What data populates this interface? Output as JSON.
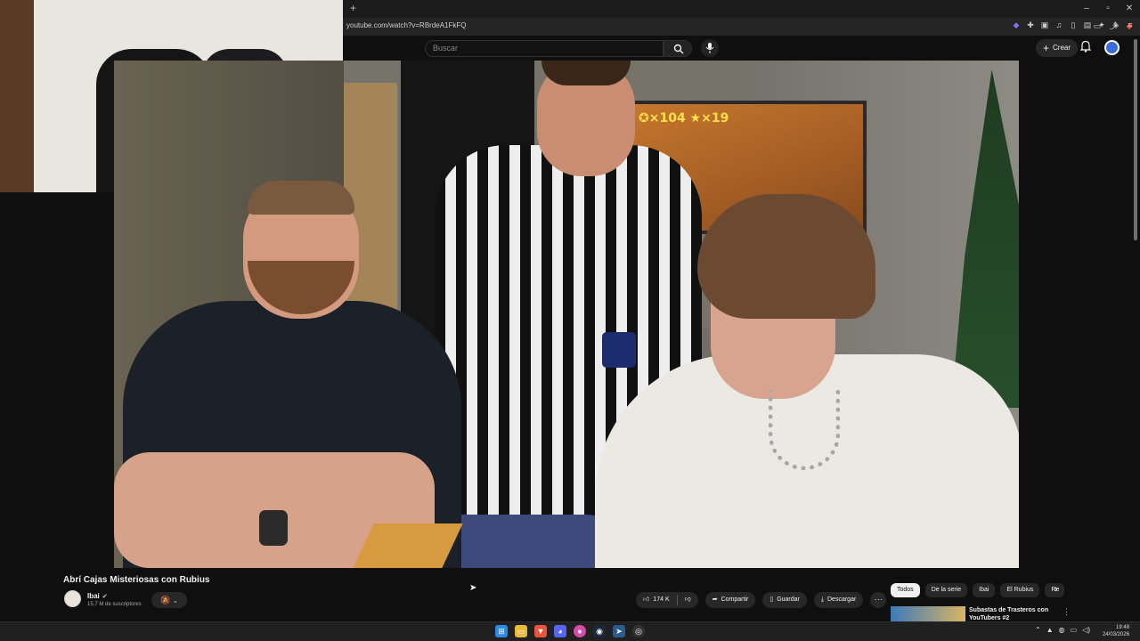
{
  "browser": {
    "new_tab_label": "+",
    "window_controls": [
      "–",
      "▫",
      "✕"
    ],
    "url": "youtube.com/watch?v=RBrdeA1FkFQ"
  },
  "youtube": {
    "search_placeholder": "Buscar",
    "create_label": "Crear",
    "video": {
      "title": "Abrí Cajas Misteriosas con Rubius",
      "tv_hud": "✪×104 ★×19"
    },
    "channel": {
      "name": "Ibai",
      "subscribers": "15,7 M de suscriptores"
    },
    "actions": {
      "likes": "174 K",
      "share": "Compartir",
      "save": "Guardar",
      "download": "Descargar",
      "more": "···"
    },
    "chips": [
      "Todos",
      "De la serie",
      "Ibai",
      "El Rubius",
      "Re"
    ],
    "suggestion": {
      "title": "Subastas de Trasteros con YouTubers #2"
    }
  },
  "taskbar": {
    "time": "19:48",
    "date": "24/03/2026"
  },
  "colors": {
    "background": "#0f0f0f",
    "chip_active": "#f1f1f1",
    "pill": "#272727"
  },
  "icons": [
    "search-icon",
    "mic-icon",
    "plus-icon",
    "bell-icon",
    "like-icon",
    "dislike-icon",
    "share-icon",
    "save-icon",
    "download-icon",
    "bell-off-icon",
    "chevron-down-icon",
    "verified-icon"
  ]
}
